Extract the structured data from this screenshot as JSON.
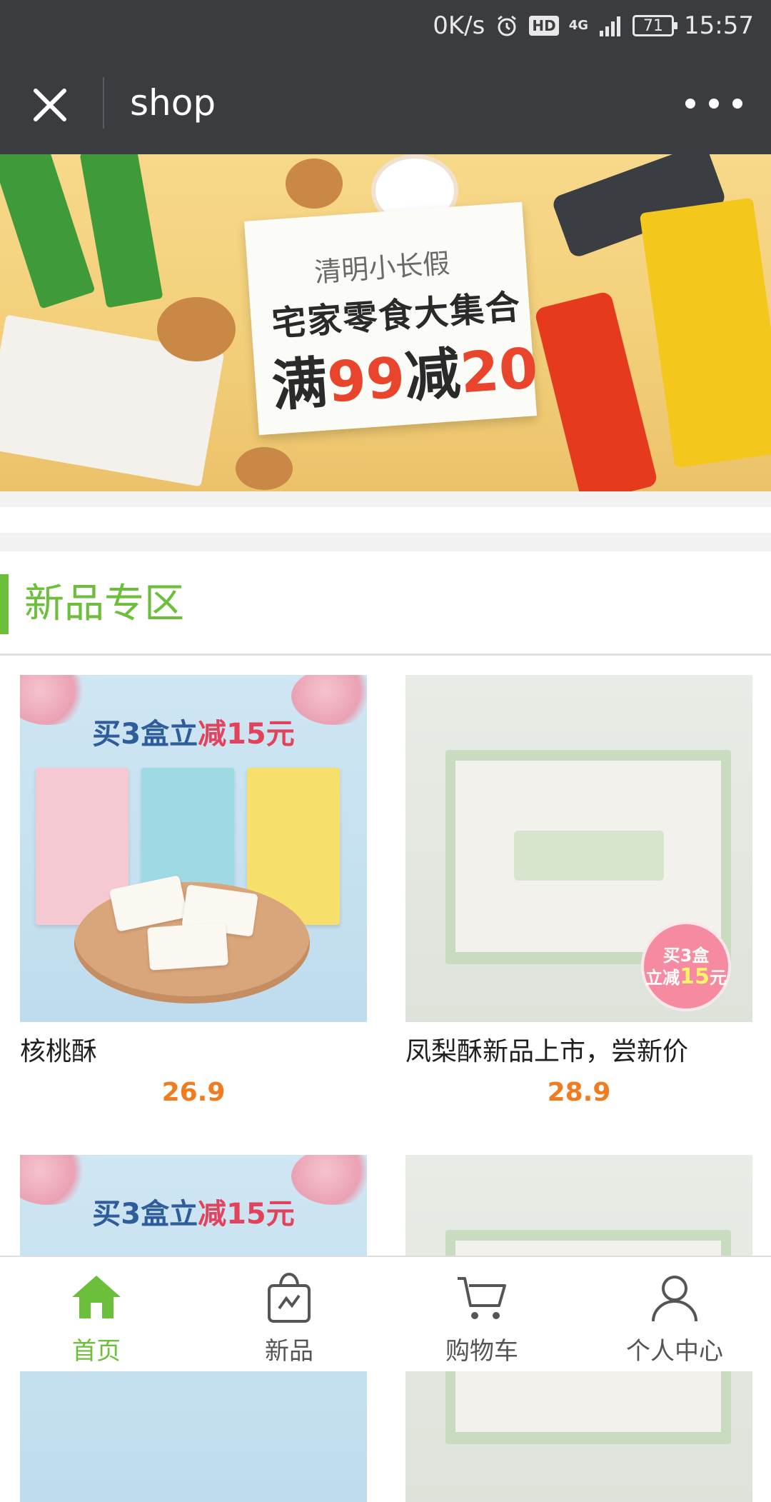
{
  "status_bar": {
    "net_speed": "0K/s",
    "hd": "HD",
    "network": "4G",
    "battery": "71",
    "time": "15:57"
  },
  "nav": {
    "title": "shop",
    "close_icon": "close-icon",
    "more_icon": "more-icon"
  },
  "banner": {
    "subtitle": "清明小长假",
    "headline": "宅家零食大集合",
    "promo_prefix": "满",
    "promo_amount1": "99",
    "promo_mid": "减",
    "promo_amount2": "20"
  },
  "section": {
    "title": "新品专区"
  },
  "products": [
    {
      "name": "核桃酥",
      "price": "26.9",
      "promo": "买3盒立",
      "promo_highlight": "减15元"
    },
    {
      "name": "凤梨酥新品上市，尝新价",
      "price": "28.9",
      "badge_line1": "买3盒",
      "badge_line2": "立减",
      "badge_num": "15",
      "badge_unit": "元"
    },
    {
      "promo": "买3盒立",
      "promo_highlight": "减15元"
    },
    {
      "name": "",
      "price": ""
    }
  ],
  "tab_bar": {
    "items": [
      {
        "label": "首页",
        "icon": "home-icon",
        "active": true
      },
      {
        "label": "新品",
        "icon": "shopping-bag-icon",
        "active": false
      },
      {
        "label": "购物车",
        "icon": "cart-icon",
        "active": false
      },
      {
        "label": "个人中心",
        "icon": "user-icon",
        "active": false
      }
    ]
  },
  "colors": {
    "accent": "#6bbf3a",
    "price": "#f07c1f",
    "header_bg": "#3b3c40"
  }
}
